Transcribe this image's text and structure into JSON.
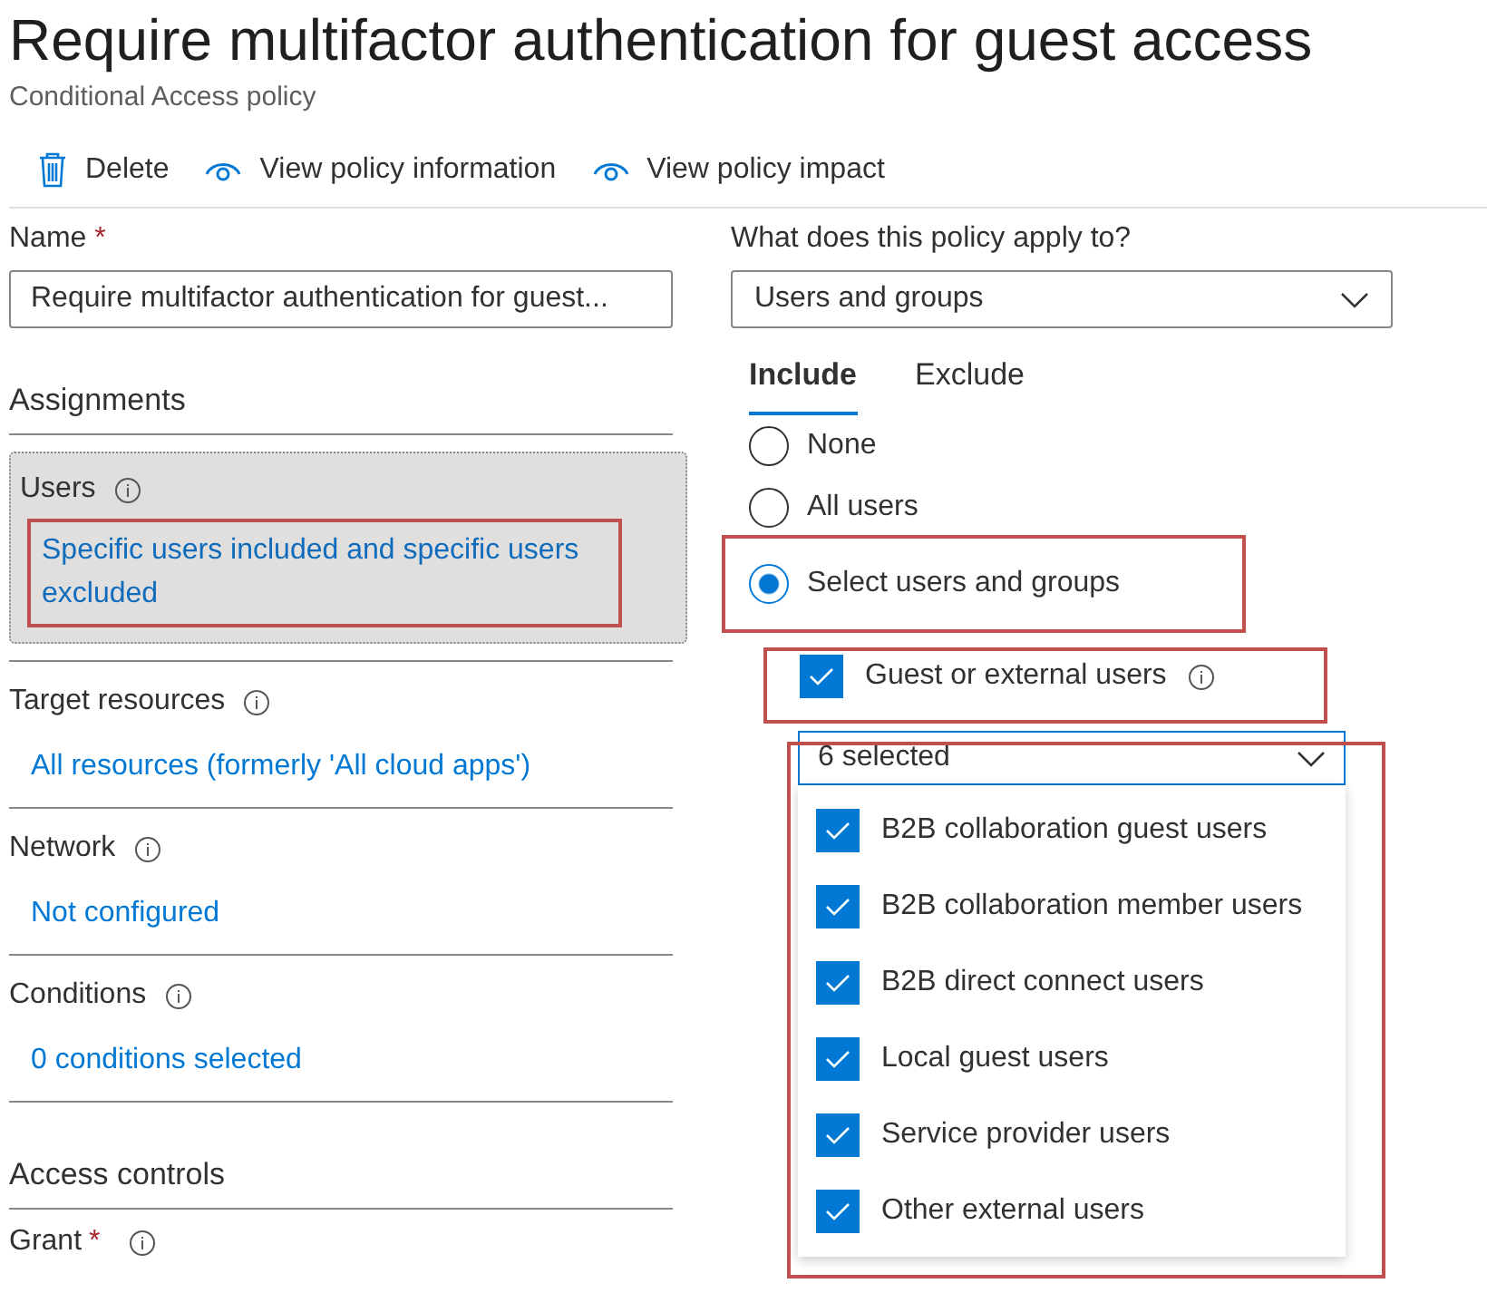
{
  "header": {
    "title": "Require multifactor authentication for guest access",
    "subtitle": "Conditional Access policy"
  },
  "toolbar": [
    {
      "kind": "delete",
      "label": "Delete"
    },
    {
      "kind": "view",
      "label": "View policy information"
    },
    {
      "kind": "view",
      "label": "View policy impact"
    }
  ],
  "name_field": {
    "label": "Name",
    "required_mark": "*",
    "value": "Require multifactor authentication for guest..."
  },
  "assignments": {
    "heading": "Assignments",
    "items": [
      {
        "label": "Users",
        "value": "Specific users included and specific users excluded",
        "selected": true,
        "highlighted": true
      },
      {
        "label": "Target resources",
        "value": "All resources (formerly 'All cloud apps')",
        "selected": false,
        "highlighted": false
      },
      {
        "label": "Network",
        "value": "Not configured",
        "selected": false,
        "highlighted": false
      },
      {
        "label": "Conditions",
        "value": "0 conditions selected",
        "selected": false,
        "highlighted": false
      }
    ]
  },
  "access_controls": {
    "heading": "Access controls",
    "grant_label": "Grant",
    "required_mark": "*"
  },
  "apply_to": {
    "label": "What does this policy apply to?",
    "value": "Users and groups"
  },
  "tabs": [
    {
      "label": "Include",
      "selected": true
    },
    {
      "label": "Exclude",
      "selected": false
    }
  ],
  "radios": [
    {
      "label": "None",
      "selected": false,
      "highlighted": false
    },
    {
      "label": "All users",
      "selected": false,
      "highlighted": false
    },
    {
      "label": "Select users and groups",
      "selected": true,
      "highlighted": true
    }
  ],
  "guest_checkbox": {
    "label": "Guest or external users",
    "checked": true,
    "highlighted": true
  },
  "guest_types": {
    "value": "6 selected",
    "highlighted": true,
    "options": [
      {
        "label": "B2B collaboration guest users",
        "checked": true
      },
      {
        "label": "B2B collaboration member users",
        "checked": true
      },
      {
        "label": "B2B direct connect users",
        "checked": true
      },
      {
        "label": "Local guest users",
        "checked": true
      },
      {
        "label": "Service provider users",
        "checked": true
      },
      {
        "label": "Other external users",
        "checked": true
      }
    ]
  }
}
